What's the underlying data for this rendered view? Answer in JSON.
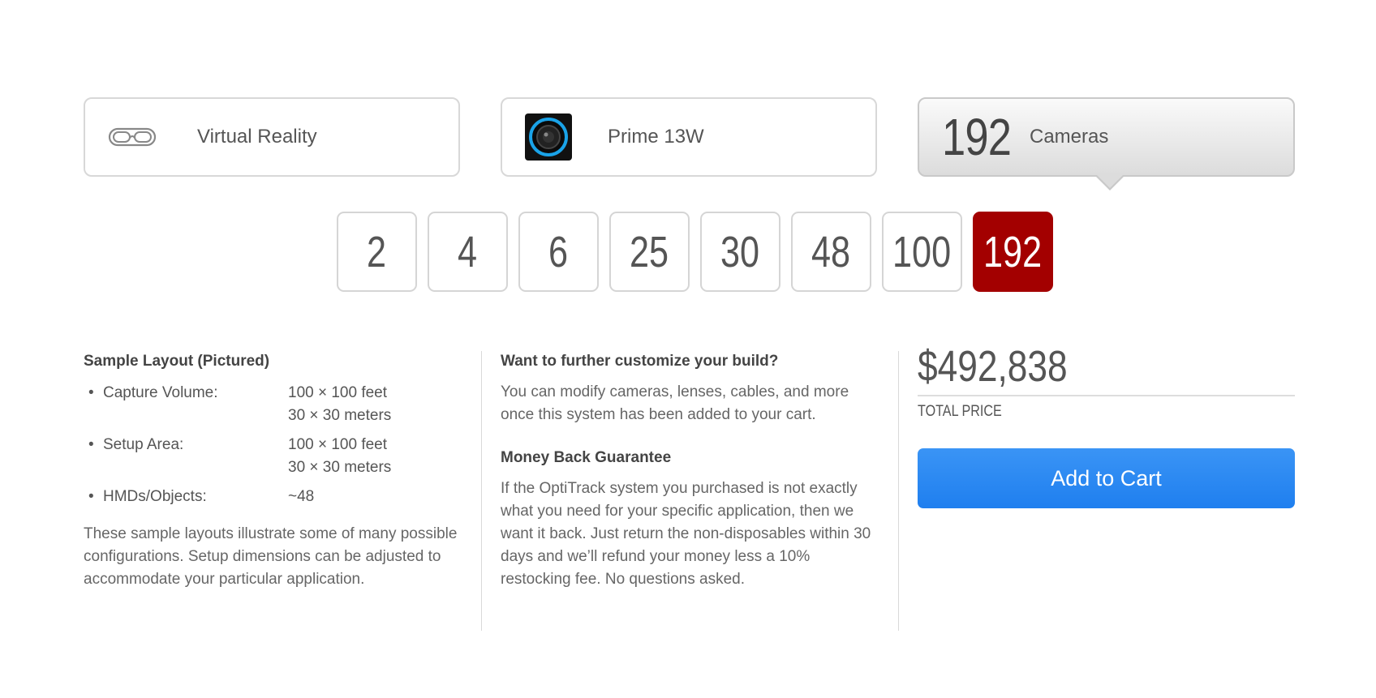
{
  "selectors": {
    "application": {
      "label": "Virtual Reality",
      "icon": "vr-headset-icon"
    },
    "camera": {
      "label": "Prime 13W",
      "icon": "camera-thumbnail"
    },
    "count": {
      "value": "192",
      "label": "Cameras"
    }
  },
  "camera_count_options": [
    {
      "label": "2",
      "active": false
    },
    {
      "label": "4",
      "active": false
    },
    {
      "label": "6",
      "active": false
    },
    {
      "label": "25",
      "active": false
    },
    {
      "label": "30",
      "active": false
    },
    {
      "label": "48",
      "active": false
    },
    {
      "label": "100",
      "active": false
    },
    {
      "label": "192",
      "active": true
    }
  ],
  "layout": {
    "title": "Sample Layout (Pictured)",
    "specs": [
      {
        "key": "Capture Volume:",
        "values": [
          "100 × 100 feet",
          "30 × 30 meters"
        ]
      },
      {
        "key": "Setup Area:",
        "values": [
          "100 × 100 feet",
          "30 × 30 meters"
        ]
      },
      {
        "key": "HMDs/Objects:",
        "values": [
          "~48"
        ]
      }
    ],
    "note": "These sample layouts illustrate some of many possible configurations. Setup dimensions can be adjusted to accommodate your particular application."
  },
  "info": {
    "customize_title": "Want to further customize your build?",
    "customize_text": "You can modify cameras, lenses, cables, and more once this system has been added to your cart.",
    "guarantee_title": "Money Back Guarantee",
    "guarantee_text": "If the OptiTrack system you purchased is not exactly what you need for your specific application, then we want it back. Just return the non-disposables within 30 days and we’ll refund your money less a 10% restocking fee. No questions asked."
  },
  "pricing": {
    "total": "$492,838",
    "total_label": "TOTAL PRICE",
    "cart_button": "Add to Cart"
  },
  "colors": {
    "active_count": "#a30000",
    "cart_button": "#2584f0"
  }
}
